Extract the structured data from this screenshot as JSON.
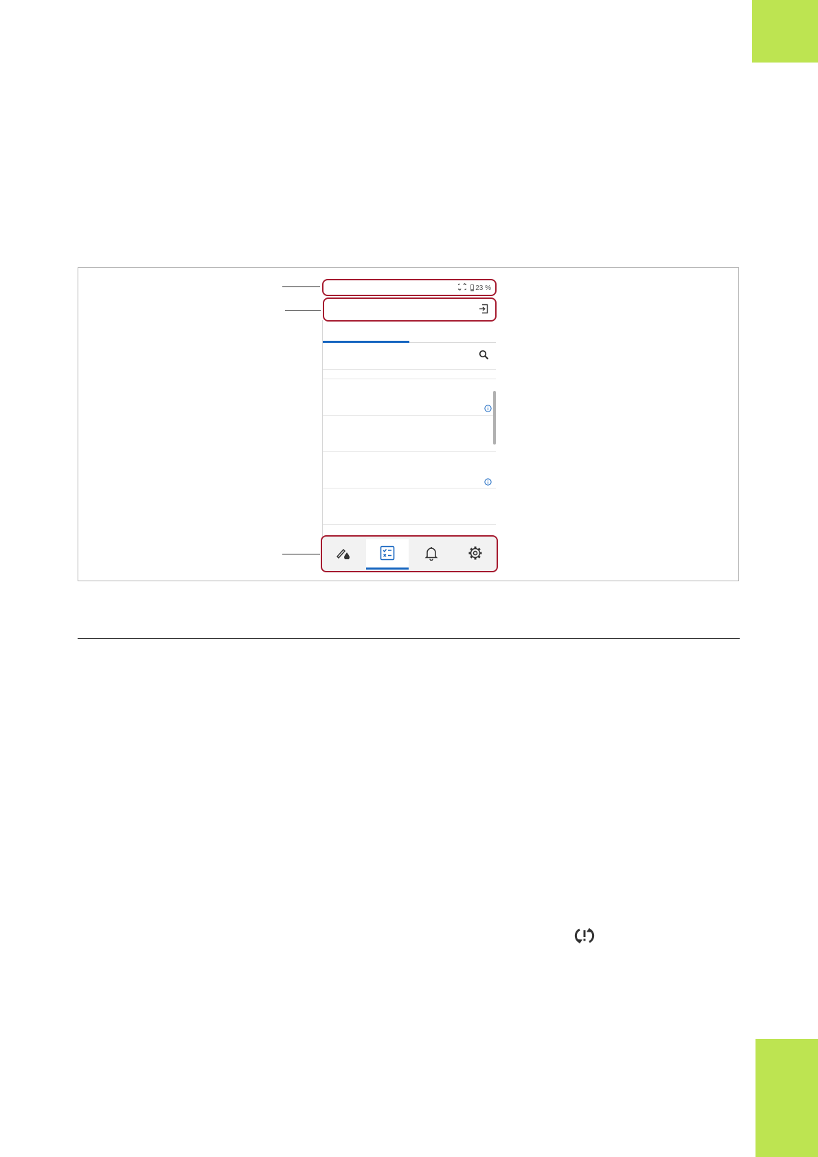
{
  "colors": {
    "accent_green": "#bde451",
    "highlight_red": "#a5192e",
    "active_blue": "#1565c0"
  },
  "status_bar": {
    "battery_text": "23 %",
    "icons": [
      "sync-icon",
      "battery-icon"
    ]
  },
  "header": {
    "icons": [
      "exit-icon"
    ]
  },
  "search": {
    "icons": [
      "search-icon"
    ]
  },
  "list": {
    "rows": [
      {
        "info_icon": true
      },
      {
        "info_icon": false
      },
      {
        "info_icon": true
      },
      {
        "info_icon": false
      }
    ]
  },
  "bottom_nav": {
    "items": [
      {
        "icon": "eraser-drop-icon",
        "selected": false
      },
      {
        "icon": "checklist-icon",
        "selected": true
      },
      {
        "icon": "bell-icon",
        "selected": false
      },
      {
        "icon": "gear-icon",
        "selected": false
      }
    ]
  },
  "body_icons": [
    "sync-warning-icon"
  ]
}
